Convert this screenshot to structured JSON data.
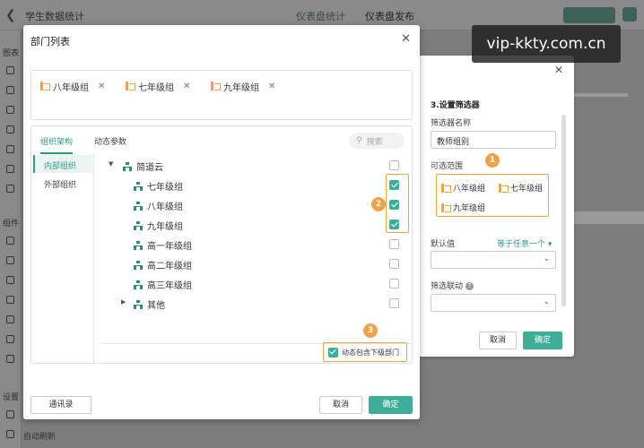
{
  "app": {
    "title": "学生数据统计",
    "tab_stats": "仪表盘统计",
    "tab_publish": "仪表盘发布",
    "rail_sections": [
      "图表",
      "组件",
      "设置"
    ],
    "auto_refresh": "自动刷新"
  },
  "modal": {
    "title": "部门列表",
    "selected": [
      "八年级组",
      "七年级组",
      "九年级组"
    ],
    "tabs": [
      "组织架构",
      "动态参数"
    ],
    "search_placeholder": "搜索",
    "left_nav": [
      "内部组织",
      "外部组织"
    ],
    "tree": {
      "root": "简道云",
      "children": [
        {
          "label": "七年级组",
          "checked": true
        },
        {
          "label": "八年级组",
          "checked": true
        },
        {
          "label": "九年级组",
          "checked": true
        },
        {
          "label": "高一年级组",
          "checked": false
        },
        {
          "label": "高二年级组",
          "checked": false
        },
        {
          "label": "高三年级组",
          "checked": false
        }
      ],
      "other": "其他"
    },
    "include_sub": "动态包含下级部门",
    "address_book": "通讯录",
    "cancel": "取消",
    "ok": "确定"
  },
  "filter": {
    "section_title": "3.设置筛选器",
    "name_label": "筛选器名称",
    "name_value": "教师组别",
    "range_label": "可选范围",
    "range_items": [
      "八年级组",
      "七年级组",
      "九年级组"
    ],
    "default_label": "默认值",
    "default_option": "等于任意一个",
    "linkage_label": "筛选联动",
    "cancel": "取消",
    "ok": "确定"
  },
  "badges": [
    "1",
    "2",
    "3"
  ],
  "watermark": "vip-kkty.com.cn"
}
